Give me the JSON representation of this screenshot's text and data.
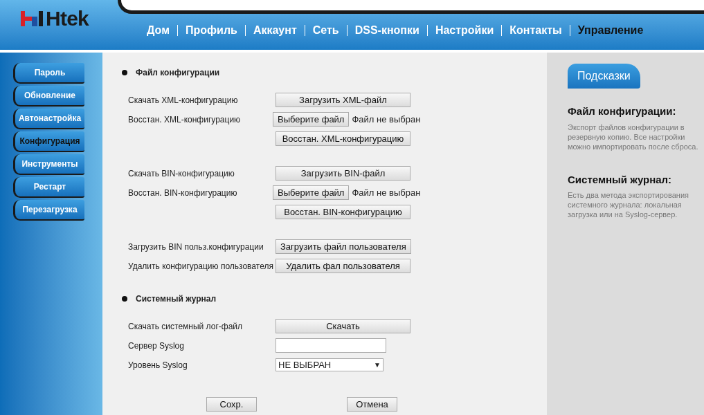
{
  "logo": "Htek",
  "nav": [
    {
      "label": "Дом",
      "selected": false
    },
    {
      "label": "Профиль",
      "selected": false
    },
    {
      "label": "Аккаунт",
      "selected": false
    },
    {
      "label": "Сеть",
      "selected": false
    },
    {
      "label": "DSS-кнопки",
      "selected": false
    },
    {
      "label": "Настройки",
      "selected": false
    },
    {
      "label": "Контакты",
      "selected": false
    },
    {
      "label": "Управление",
      "selected": true
    }
  ],
  "sidebar": [
    {
      "label": "Пароль",
      "selected": false
    },
    {
      "label": "Обновление",
      "selected": false
    },
    {
      "label": "Автонастройка",
      "selected": false
    },
    {
      "label": "Конфигурация",
      "selected": true
    },
    {
      "label": "Инструменты",
      "selected": false
    },
    {
      "label": "Рестарт",
      "selected": false
    },
    {
      "label": "Перезагрузка",
      "selected": false
    }
  ],
  "sections": [
    {
      "title": "Файл конфигурации",
      "groups": [
        [
          {
            "kind": "button",
            "label": "Скачать XML-конфигурацию",
            "button": "Загрузить XML-файл"
          },
          {
            "kind": "file",
            "label": "Восстан. XML-конфигурацию",
            "button": "Выберите файл",
            "status": "Файл не выбран"
          },
          {
            "kind": "button",
            "button": "Восстан. XML-конфигурацию"
          }
        ],
        [
          {
            "kind": "button",
            "label": "Скачать BIN-конфигурацию",
            "button": "Загрузить BIN-файл"
          },
          {
            "kind": "file",
            "label": "Восстан. BIN-конфигурацию",
            "button": "Выберите файл",
            "status": "Файл не выбран"
          },
          {
            "kind": "button",
            "button": "Восстан. BIN-конфигурацию"
          }
        ],
        [
          {
            "kind": "button",
            "label": "Загрузить BIN польз.конфигурации",
            "button": "Загрузить файл пользователя"
          },
          {
            "kind": "button",
            "label": "Удалить конфигурацию пользователя",
            "button": "Удалить фал пользователя"
          }
        ]
      ]
    },
    {
      "title": "Системный журнал",
      "groups": [
        [
          {
            "kind": "button",
            "label": "Скачать системный лог-файл",
            "button": "Скачать"
          },
          {
            "kind": "input",
            "label": "Сервер Syslog"
          },
          {
            "kind": "select",
            "label": "Уровень Syslog",
            "value": "НЕ ВЫБРАН",
            "arrow": "▼"
          }
        ]
      ]
    }
  ],
  "footer_buttons": [
    "Сохр.",
    "Отмена"
  ],
  "hints": {
    "title": "Подсказки",
    "items": [
      {
        "heading": "Файл конфигурации:",
        "text": "Экспорт файлов конфигурации в резервную копию. Все настройки можно импортировать после сброса."
      },
      {
        "heading": "Системный журнал:",
        "text": "Есть два метода экспортирования системного журнала: локальная загрузка или на Syslog-сервер."
      }
    ]
  }
}
